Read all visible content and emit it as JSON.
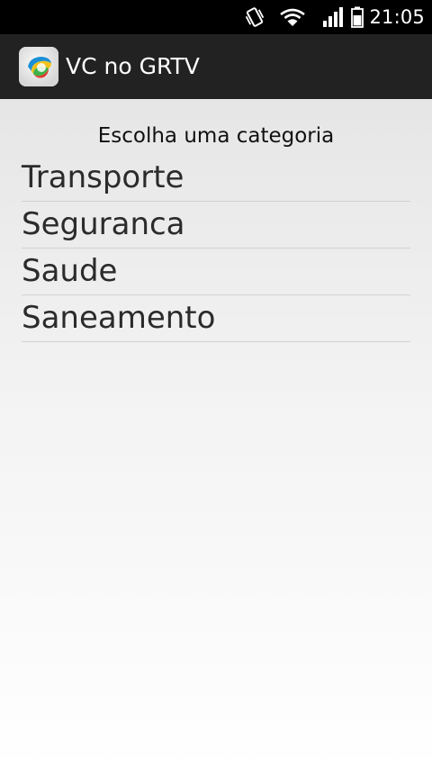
{
  "status_bar": {
    "time": "21:05",
    "icons": [
      "vibrate-icon",
      "wifi-icon",
      "signal-icon",
      "battery-icon"
    ]
  },
  "action_bar": {
    "app_icon": "app-logo-icon",
    "title": "VC no GRTV"
  },
  "content": {
    "prompt": "Escolha uma categoria",
    "categories": [
      {
        "label": "Transporte"
      },
      {
        "label": "Seguranca"
      },
      {
        "label": "Saude"
      },
      {
        "label": "Saneamento"
      }
    ]
  },
  "colors": {
    "status_bar_bg": "#000000",
    "action_bar_bg": "#222222",
    "content_bg_top": "#e6e6e6",
    "content_bg_bottom": "#ffffff",
    "text_primary": "#2b2b2b",
    "divider": "#d2d2d2"
  }
}
